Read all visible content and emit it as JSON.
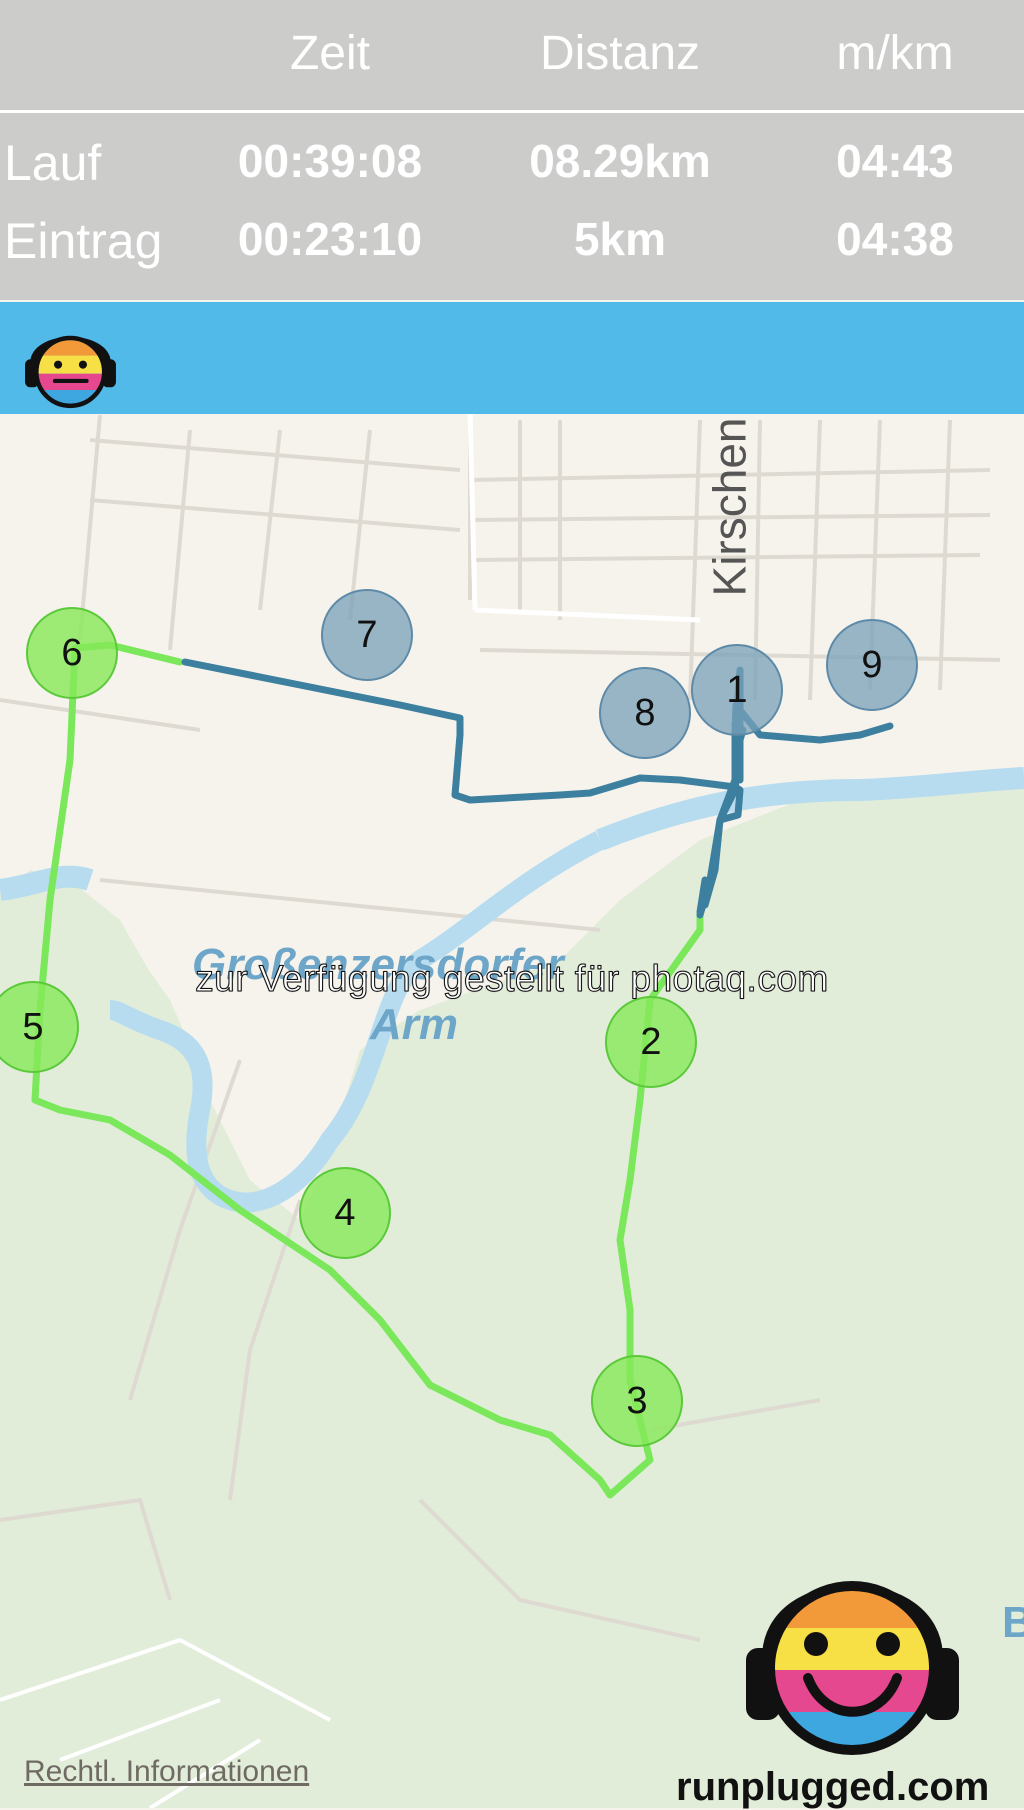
{
  "stats": {
    "headers": {
      "time": "Zeit",
      "distance": "Distanz",
      "pace": "m/km"
    },
    "rows": [
      {
        "label": "Lauf",
        "time": "00:39:08",
        "distance": "08.29km",
        "pace": "04:43"
      },
      {
        "label": "Eintrag",
        "time": "00:23:10",
        "distance": "5km",
        "pace": "04:38"
      }
    ]
  },
  "map": {
    "street_label": "Kirschen",
    "river_label_line1": "Großenzersdorfer",
    "river_label_line2": "Arm",
    "edge_letter": "B",
    "markers": [
      {
        "label": "1",
        "style": "blue"
      },
      {
        "label": "2",
        "style": "green"
      },
      {
        "label": "3",
        "style": "green"
      },
      {
        "label": "4",
        "style": "green"
      },
      {
        "label": "5",
        "style": "green"
      },
      {
        "label": "6",
        "style": "green"
      },
      {
        "label": "7",
        "style": "blue"
      },
      {
        "label": "8",
        "style": "blue"
      },
      {
        "label": "9",
        "style": "blue"
      }
    ]
  },
  "watermark": "zur Verfügung gestellt für photaq.com",
  "legal_link": "Rechtl. Informationen",
  "brand": "runplugged.com",
  "colors": {
    "header_bg": "#c8c8c8",
    "bar_blue": "#52bae9",
    "route_green": "#7ae85a",
    "route_blue": "#3d7f9f",
    "water": "#b5dcf0",
    "park": "#e3eedb"
  },
  "icons": [
    "runplugged-logo-icon"
  ]
}
